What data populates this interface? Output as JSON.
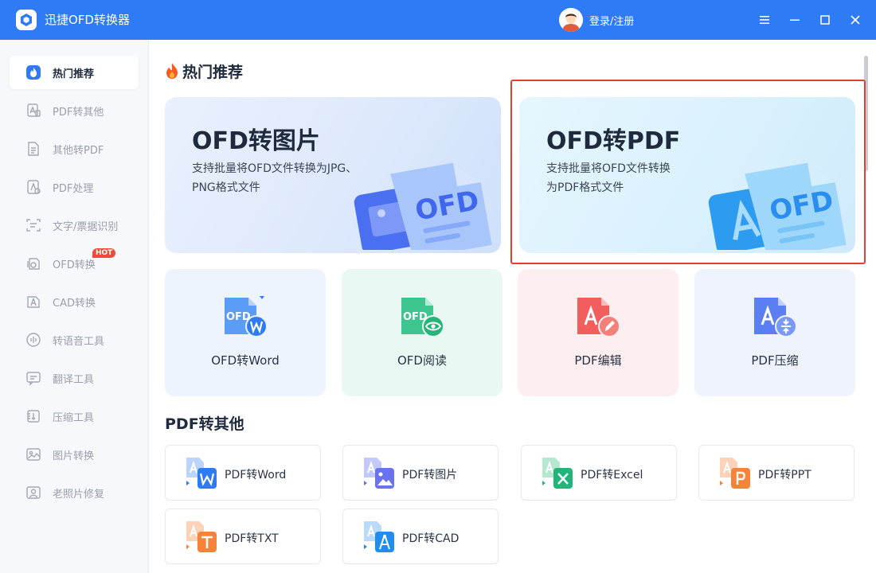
{
  "app": {
    "title": "迅捷OFD转换器",
    "login_label": "登录/注册"
  },
  "sidebar": {
    "items": [
      {
        "label": "热门推荐",
        "icon": "flame-icon",
        "active": true
      },
      {
        "label": "PDF转其他",
        "icon": "pdf-export-icon"
      },
      {
        "label": "其他转PDF",
        "icon": "doc-to-pdf-icon"
      },
      {
        "label": "PDF处理",
        "icon": "pdf-process-icon"
      },
      {
        "label": "文字/票据识别",
        "icon": "ocr-icon"
      },
      {
        "label": "OFD转换",
        "icon": "ofd-convert-icon",
        "badge": "HOT"
      },
      {
        "label": "CAD转换",
        "icon": "cad-icon"
      },
      {
        "label": "转语音工具",
        "icon": "voice-icon"
      },
      {
        "label": "翻译工具",
        "icon": "translate-icon"
      },
      {
        "label": "压缩工具",
        "icon": "compress-icon"
      },
      {
        "label": "图片转换",
        "icon": "image-icon"
      },
      {
        "label": "老照片修复",
        "icon": "photo-restore-icon"
      }
    ]
  },
  "hot": {
    "title": "热门推荐",
    "cards": [
      {
        "title": "OFD转图片",
        "desc": "支持批量将OFD文件转换为JPG、PNG格式文件"
      },
      {
        "title": "OFD转PDF",
        "desc": "支持批量将OFD文件转换为PDF格式文件"
      }
    ],
    "tools": [
      {
        "label": "OFD转Word"
      },
      {
        "label": "OFD阅读"
      },
      {
        "label": "PDF编辑"
      },
      {
        "label": "PDF压缩"
      }
    ]
  },
  "pdf_other": {
    "title": "PDF转其他",
    "items": [
      {
        "label": "PDF转Word"
      },
      {
        "label": "PDF转图片"
      },
      {
        "label": "PDF转Excel"
      },
      {
        "label": "PDF转PPT"
      },
      {
        "label": "PDF转TXT"
      },
      {
        "label": "PDF转CAD"
      }
    ]
  },
  "colors": {
    "brand": "#2f7bf5",
    "highlight": "#e0402f",
    "hot_badge": "#f5483b"
  }
}
